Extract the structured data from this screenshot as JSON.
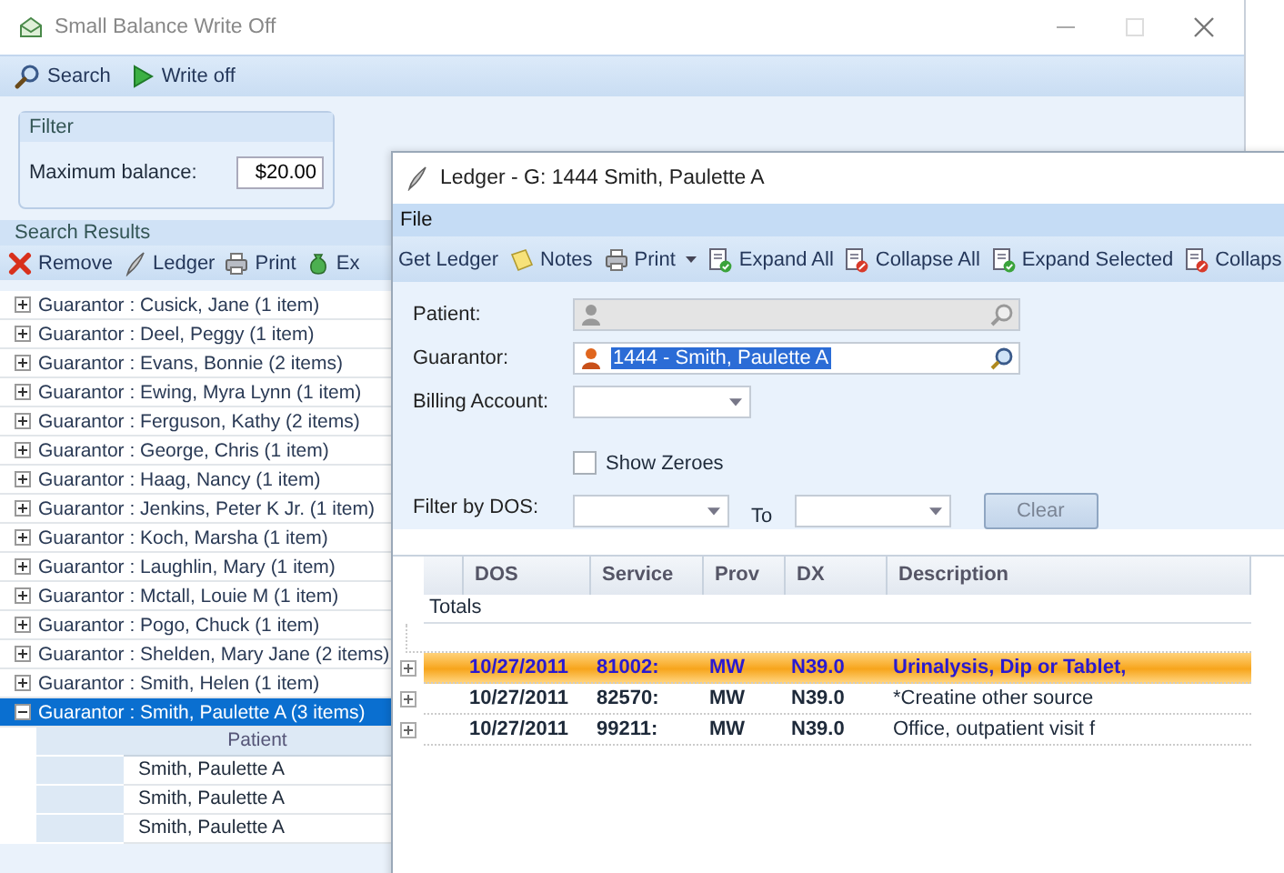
{
  "back_window": {
    "title": "Small Balance Write Off",
    "toolbar": [
      {
        "label": "Search",
        "kind": "search"
      },
      {
        "label": "Write off",
        "kind": "play"
      }
    ],
    "filter": {
      "title": "Filter",
      "label": "Maximum balance:",
      "value": "$20.00"
    },
    "results": {
      "title": "Search Results",
      "toolbar": [
        {
          "label": "Remove",
          "kind": "remove"
        },
        {
          "label": "Ledger",
          "kind": "ledger"
        },
        {
          "label": "Print",
          "kind": "print"
        },
        {
          "label": "Ex",
          "kind": "money"
        }
      ],
      "groups": [
        {
          "label": "Guarantor : Cusick, Jane (1 item)",
          "expanded": false,
          "selected": false
        },
        {
          "label": "Guarantor : Deel, Peggy (1 item)",
          "expanded": false,
          "selected": false
        },
        {
          "label": "Guarantor : Evans, Bonnie (2 items)",
          "expanded": false,
          "selected": false
        },
        {
          "label": "Guarantor : Ewing, Myra Lynn (1 item)",
          "expanded": false,
          "selected": false
        },
        {
          "label": "Guarantor : Ferguson, Kathy (2 items)",
          "expanded": false,
          "selected": false
        },
        {
          "label": "Guarantor : George, Chris (1 item)",
          "expanded": false,
          "selected": false
        },
        {
          "label": "Guarantor : Haag, Nancy (1 item)",
          "expanded": false,
          "selected": false
        },
        {
          "label": "Guarantor : Jenkins, Peter K Jr. (1 item)",
          "expanded": false,
          "selected": false
        },
        {
          "label": "Guarantor : Koch, Marsha (1 item)",
          "expanded": false,
          "selected": false
        },
        {
          "label": "Guarantor : Laughlin, Mary (1 item)",
          "expanded": false,
          "selected": false
        },
        {
          "label": "Guarantor : Mctall, Louie M (1 item)",
          "expanded": false,
          "selected": false
        },
        {
          "label": "Guarantor : Pogo, Chuck (1 item)",
          "expanded": false,
          "selected": false
        },
        {
          "label": "Guarantor : Shelden, Mary Jane (2 items)",
          "expanded": false,
          "selected": false
        },
        {
          "label": "Guarantor : Smith, Helen (1 item)",
          "expanded": false,
          "selected": false
        },
        {
          "label": "Guarantor : Smith, Paulette A (3 items)",
          "expanded": true,
          "selected": true,
          "column": "Patient",
          "rows": [
            "Smith, Paulette A",
            "Smith, Paulette A",
            "Smith, Paulette A"
          ]
        }
      ]
    }
  },
  "ledger_window": {
    "title": "Ledger - G: 1444 Smith, Paulette A",
    "menu": [
      "File"
    ],
    "toolbar": [
      {
        "label": "Get Ledger",
        "kind": "text"
      },
      {
        "label": "Notes",
        "kind": "notes"
      },
      {
        "label": "Print",
        "kind": "print",
        "dropdown": true
      },
      {
        "label": "Expand All",
        "kind": "expand"
      },
      {
        "label": "Collapse All",
        "kind": "collapse"
      },
      {
        "label": "Expand Selected",
        "kind": "expand"
      },
      {
        "label": "Collaps",
        "kind": "collapse"
      }
    ],
    "patient": {
      "label": "Patient:",
      "disabled": true
    },
    "guarantor": {
      "label": "Guarantor:",
      "value": "1444 - Smith, Paulette A",
      "disabled": false
    },
    "billing_account": {
      "label": "Billing Account:"
    },
    "show_zeroes": {
      "label": "Show Zeroes",
      "checked": false
    },
    "filter_dos": {
      "label": "Filter by DOS:",
      "to_label": "To",
      "clear": {
        "label": "Clear",
        "disabled": true
      }
    },
    "grid": {
      "columns": [
        "DOS",
        "Service",
        "Prov",
        "DX",
        "Description"
      ],
      "totals_label": "Totals",
      "rows": [
        {
          "dos": "10/27/2011",
          "service": "81002:",
          "prov": "MW",
          "dx": "N39.0",
          "description": "Urinalysis, Dip or Tablet,",
          "selected": true
        },
        {
          "dos": "10/27/2011",
          "service": "82570:",
          "prov": "MW",
          "dx": "N39.0",
          "description": "*Creatine other source",
          "selected": false
        },
        {
          "dos": "10/27/2011",
          "service": "99211:",
          "prov": "MW",
          "dx": "N39.0",
          "description": "Office, outpatient visit f",
          "selected": false
        }
      ]
    }
  }
}
